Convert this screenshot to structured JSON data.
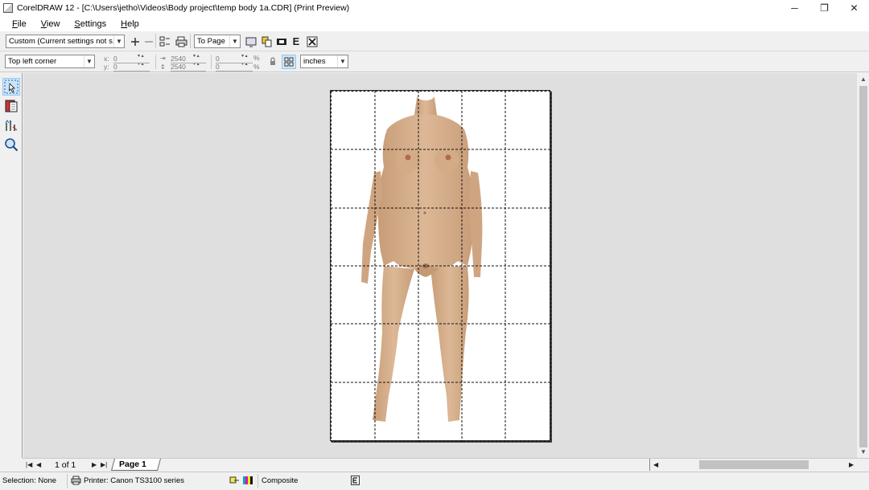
{
  "window": {
    "title": "CorelDRAW 12 - [C:\\Users\\jetho\\Videos\\Body project\\temp body 1a.CDR] (Print Preview)",
    "minimize_glyph": "─",
    "restore_glyph": "❐",
    "close_glyph": "✕"
  },
  "menu": {
    "items": [
      {
        "label": "File"
      },
      {
        "label": "View"
      },
      {
        "label": "Settings"
      },
      {
        "label": "Help"
      }
    ]
  },
  "toolbar": {
    "preset_value": "Custom (Current settings not s...",
    "fit_value": "To Page",
    "position_value": "Top left corner",
    "x_label": "x:",
    "x_value": "0",
    "y_label": "y:",
    "y_value": "0",
    "width_value": "2540",
    "height_value": "2540",
    "pct_x_value": "0",
    "pct_y_value": "0",
    "pct_symbol": "%",
    "units_value": "inches",
    "e_glyph": "E"
  },
  "pagebar": {
    "page_count": "1 of 1",
    "page_tab": "Page 1"
  },
  "status": {
    "selection": "Selection: None",
    "printer": "Printer: Canon TS3100 series",
    "mode": "Composite"
  },
  "preview": {
    "grid_columns": 5,
    "grid_rows": 6,
    "body_fill": "#d9b38f",
    "body_shade": "#c49a74",
    "nipple_color": "#b06a50"
  }
}
